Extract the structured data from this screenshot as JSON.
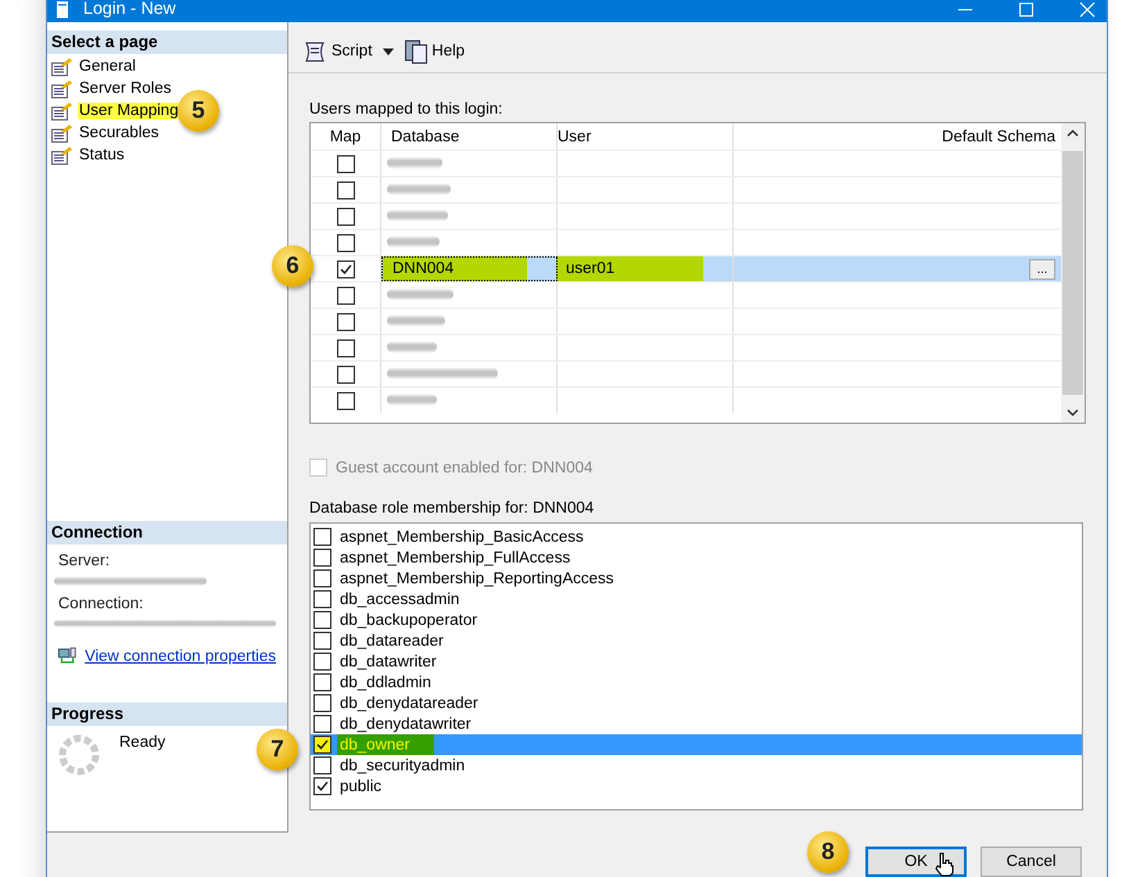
{
  "window": {
    "title": "Login - New"
  },
  "sidebar": {
    "header": "Select a page",
    "items": [
      {
        "label": "General",
        "highlighted": false
      },
      {
        "label": "Server Roles",
        "highlighted": false
      },
      {
        "label": "User Mapping",
        "highlighted": true
      },
      {
        "label": "Securables",
        "highlighted": false
      },
      {
        "label": "Status",
        "highlighted": false
      }
    ]
  },
  "connection": {
    "header": "Connection",
    "server_label": "Server:",
    "connection_label": "Connection:",
    "link": "View connection properties"
  },
  "progress": {
    "header": "Progress",
    "status": "Ready"
  },
  "toolbar": {
    "script": "Script",
    "help": "Help"
  },
  "mapping": {
    "label": "Users mapped to this login:",
    "columns": [
      "Map",
      "Database",
      "User",
      "Default Schema"
    ],
    "rows": [
      {
        "checked": false,
        "selected": false
      },
      {
        "checked": false,
        "selected": false
      },
      {
        "checked": false,
        "selected": false
      },
      {
        "checked": false,
        "selected": false
      },
      {
        "checked": true,
        "selected": true,
        "database": "DNN004",
        "user": "user01",
        "highlighted": true,
        "button": "..."
      },
      {
        "checked": false,
        "selected": false
      },
      {
        "checked": false,
        "selected": false
      },
      {
        "checked": false,
        "selected": false
      },
      {
        "checked": false,
        "selected": false
      },
      {
        "checked": false,
        "selected": false
      }
    ]
  },
  "guest": {
    "label": "Guest account enabled for: DNN004",
    "checked": false,
    "disabled": true
  },
  "roles": {
    "label": "Database role membership for: DNN004",
    "items": [
      {
        "name": "aspnet_Membership_BasicAccess",
        "checked": false,
        "selected": false
      },
      {
        "name": "aspnet_Membership_FullAccess",
        "checked": false,
        "selected": false
      },
      {
        "name": "aspnet_Membership_ReportingAccess",
        "checked": false,
        "selected": false
      },
      {
        "name": "db_accessadmin",
        "checked": false,
        "selected": false
      },
      {
        "name": "db_backupoperator",
        "checked": false,
        "selected": false
      },
      {
        "name": "db_datareader",
        "checked": false,
        "selected": false
      },
      {
        "name": "db_datawriter",
        "checked": false,
        "selected": false
      },
      {
        "name": "db_ddladmin",
        "checked": false,
        "selected": false
      },
      {
        "name": "db_denydatareader",
        "checked": false,
        "selected": false
      },
      {
        "name": "db_denydatawriter",
        "checked": false,
        "selected": false
      },
      {
        "name": "db_owner",
        "checked": true,
        "selected": true,
        "highlighted": true
      },
      {
        "name": "db_securityadmin",
        "checked": false,
        "selected": false
      },
      {
        "name": "public",
        "checked": true,
        "selected": false
      }
    ]
  },
  "buttons": [
    {
      "label": "OK",
      "focused": true
    },
    {
      "label": "Cancel",
      "focused": false
    }
  ],
  "callouts": [
    "5",
    "6",
    "7",
    "8"
  ]
}
